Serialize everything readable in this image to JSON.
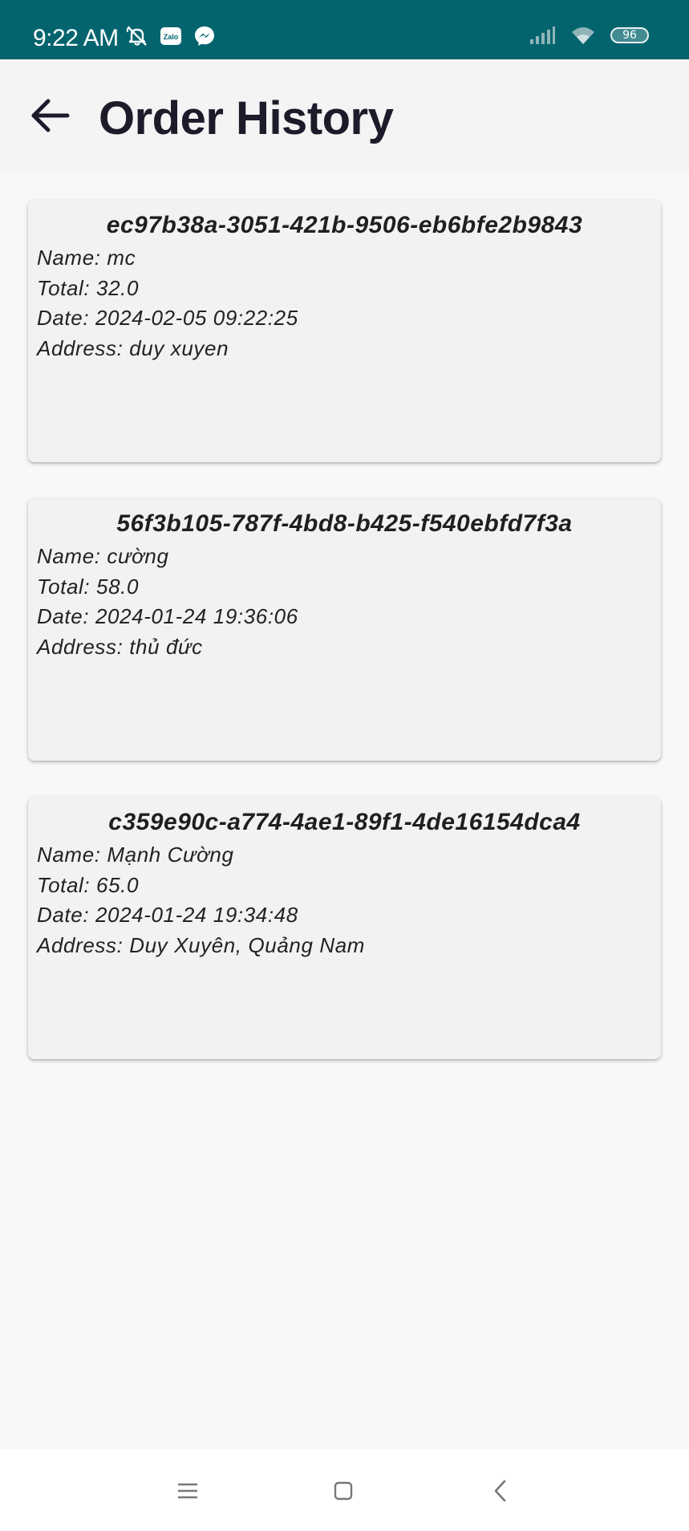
{
  "status_bar": {
    "time": "9:22 AM",
    "battery": "96",
    "left_icons": [
      "alarm-off-icon",
      "zalo-icon",
      "messenger-icon"
    ],
    "right_icons": [
      "signal-icon",
      "wifi-icon",
      "battery-icon"
    ]
  },
  "app_bar": {
    "title": "Order History",
    "back_icon": "arrow-back-icon"
  },
  "orders": [
    {
      "id": "ec97b38a-3051-421b-9506-eb6bfe2b9843",
      "name": "Name: mc",
      "total": "Total: 32.0",
      "date": "Date: 2024-02-05 09:22:25",
      "address": "Address: duy xuyen"
    },
    {
      "id": "56f3b105-787f-4bd8-b425-f540ebfd7f3a",
      "name": "Name: cường",
      "total": "Total: 58.0",
      "date": "Date: 2024-01-24 19:36:06",
      "address": "Address: thủ đức"
    },
    {
      "id": "c359e90c-a774-4ae1-89f1-4de16154dca4",
      "name": "Name: Mạnh Cường",
      "total": "Total: 65.0",
      "date": "Date: 2024-01-24 19:34:48",
      "address": "Address: Duy Xuyên, Quảng Nam"
    }
  ],
  "nav_bar": {
    "buttons": [
      "menu-icon",
      "home-icon",
      "back-icon"
    ]
  },
  "colors": {
    "status_bar": "#03646e",
    "app_bar": "#f4f4f4",
    "card": "#f2f2f2",
    "background": "#f7f8f8",
    "title_text": "#1d1b2a"
  }
}
